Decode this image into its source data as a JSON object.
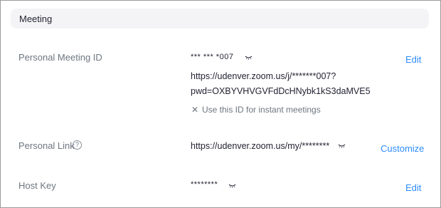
{
  "section": {
    "title": "Meeting"
  },
  "personal_meeting_id": {
    "label": "Personal Meeting ID",
    "masked_id": "*** *** *007",
    "invite_link_line1": "https://udenver.zoom.us/j/*******007?",
    "invite_link_line2": "pwd=OXBYVHVGVFdDcHNybk1kS3daMVE5",
    "option_label": "Use this ID for instant meetings",
    "option_icon": "close-icon",
    "action_label": "Edit"
  },
  "personal_link": {
    "label": "Personal Link",
    "help_glyph": "?",
    "value": "https://udenver.zoom.us/my/********",
    "action_label": "Customize"
  },
  "host_key": {
    "label": "Host Key",
    "masked_value": "********",
    "action_label": "Edit"
  },
  "colors": {
    "link": "#2d8cff",
    "label": "#6e7680",
    "text": "#232333",
    "header_bg": "#f4f4f6"
  }
}
